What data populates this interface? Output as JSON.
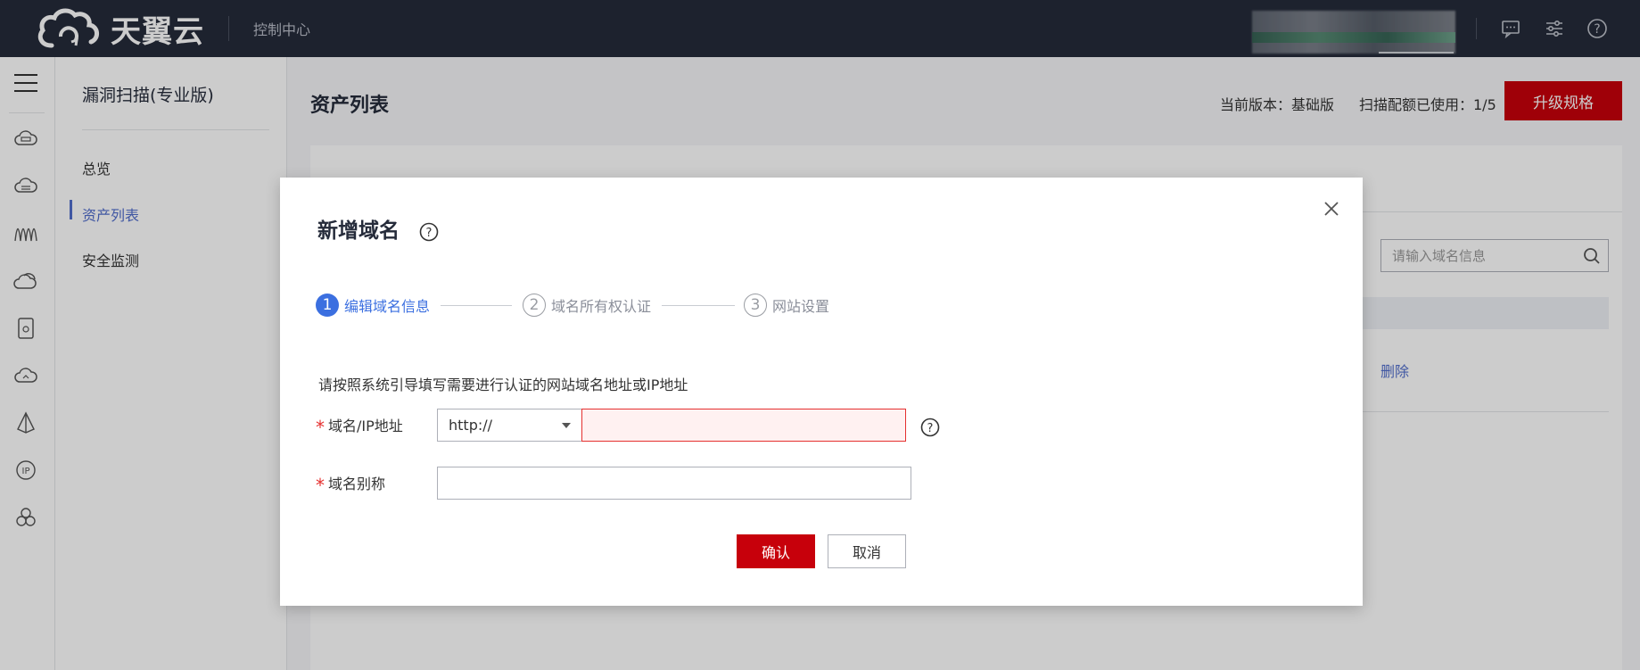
{
  "topbar": {
    "brand": "天翼云",
    "console_link": "控制中心",
    "icons": [
      "message-icon",
      "settings-sliders-icon",
      "help-icon"
    ]
  },
  "rail": {
    "icons": [
      "cloud-server-icon",
      "cloud-host-icon",
      "network-icon",
      "cloud-stack-icon",
      "storage-icon",
      "cloud-monitor-icon",
      "cdn-icon",
      "ip-icon",
      "cluster-icon"
    ]
  },
  "sidebar": {
    "title": "漏洞扫描(专业版)",
    "items": [
      {
        "label": "总览"
      },
      {
        "label": "资产列表"
      },
      {
        "label": "安全监测"
      }
    ]
  },
  "main": {
    "title": "资产列表",
    "version": "当前版本：基础版",
    "quota": "扫描配额已使用：1/5",
    "upgrade_label": "升级规格",
    "search_placeholder": "请输入域名信息",
    "delete_link": "删除"
  },
  "modal": {
    "title": "新增域名",
    "steps": [
      {
        "num": "1",
        "label": "编辑域名信息"
      },
      {
        "num": "2",
        "label": "域名所有权认证"
      },
      {
        "num": "3",
        "label": "网站设置"
      }
    ],
    "intro": "请按照系统引导填写需要进行认证的网站域名地址或IP地址",
    "domain_label": "域名/IP地址",
    "protocol_value": "http://",
    "domain_value": "",
    "alias_label": "域名别称",
    "alias_value": "",
    "confirm_label": "确认",
    "cancel_label": "取消"
  },
  "colors": {
    "topbar": "#252b3a",
    "accent_red": "#c7000b",
    "active_blue": "#3b6fe0",
    "error_red": "#e5302f"
  }
}
